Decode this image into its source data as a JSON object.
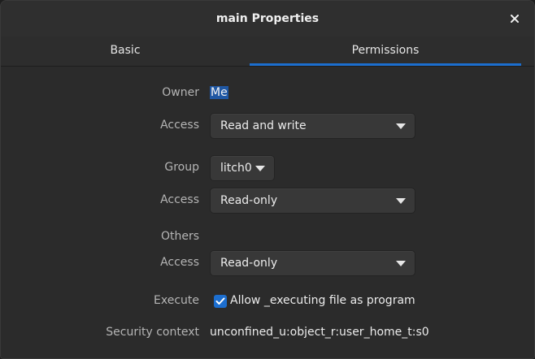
{
  "window": {
    "title": "main Properties",
    "close_glyph": "×"
  },
  "tabs": [
    {
      "label": "Basic",
      "active": false
    },
    {
      "label": "Permissions",
      "active": true
    }
  ],
  "owner": {
    "label": "Owner",
    "value": "Me"
  },
  "owner_access": {
    "label": "Access",
    "value": "Read and write"
  },
  "group": {
    "label": "Group",
    "value": "litch0"
  },
  "group_access": {
    "label": "Access",
    "value": "Read-only"
  },
  "others": {
    "label": "Others"
  },
  "others_access": {
    "label": "Access",
    "value": "Read-only"
  },
  "execute": {
    "label": "Execute",
    "checkbox_label": "Allow _executing file as program",
    "checked": true
  },
  "security": {
    "label": "Security context",
    "value": "unconfined_u:object_r:user_home_t:s0"
  },
  "colors": {
    "accent": "#1c6ecf",
    "selection": "#1f57a3",
    "background": "#2b2b2b"
  }
}
